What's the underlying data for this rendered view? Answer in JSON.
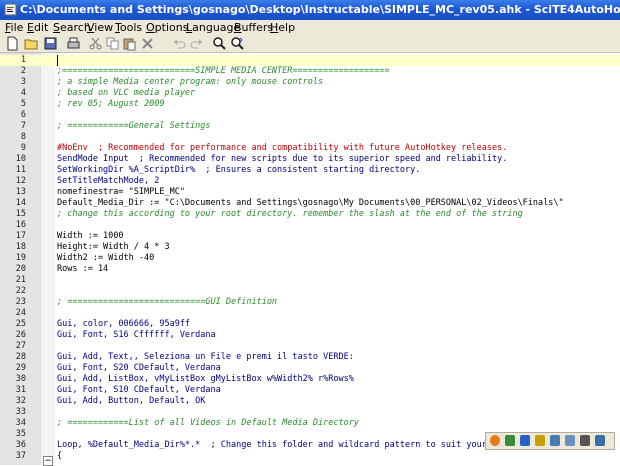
{
  "window": {
    "title": "C:\\Documents and Settings\\gosnago\\Desktop\\Instructable\\SIMPLE_MC_rev05.ahk - SciTE4AutoHotkey"
  },
  "menu": [
    "File",
    "Edit",
    "Search",
    "View",
    "Tools",
    "Options",
    "Language",
    "Buffers",
    "Help"
  ],
  "toolbar": [
    "new-file-icon",
    "open-folder-icon",
    "save-icon",
    "print-icon",
    "cut-icon",
    "copy-icon",
    "paste-icon",
    "delete-icon",
    "undo-icon",
    "redo-icon",
    "find-icon",
    "replace-icon"
  ],
  "editor": {
    "current_line": 1,
    "lines": [
      {
        "n": "1",
        "t": "",
        "s": "plain"
      },
      {
        "n": "2",
        "t": ";==========================SIMPLE MEDIA CENTER===================",
        "s": "comment"
      },
      {
        "n": "3",
        "t": "; a simple Media center program: only mouse controls",
        "s": "comment"
      },
      {
        "n": "4",
        "t": "; based on VLC media player",
        "s": "comment"
      },
      {
        "n": "5",
        "t": "; rev 05; August 2009",
        "s": "comment"
      },
      {
        "n": "6",
        "t": "",
        "s": "plain"
      },
      {
        "n": "7",
        "t": "; ============General Settings",
        "s": "comment"
      },
      {
        "n": "8",
        "t": "",
        "s": "plain"
      },
      {
        "n": "9",
        "t": "#NoEnv  ; Recommended for performance and compatibility with future AutoHotkey releases.",
        "s": "directive"
      },
      {
        "n": "10",
        "t": "SendMode Input  ; Recommended for new scripts due to its superior speed and reliability.",
        "s": "cmd"
      },
      {
        "n": "11",
        "t": "SetWorkingDir %A_ScriptDir%  ; Ensures a consistent starting directory.",
        "s": "cmd"
      },
      {
        "n": "12",
        "t": "SetTitleMatchMode, 2",
        "s": "cmd"
      },
      {
        "n": "13",
        "t": "nomefinestra= \"SIMPLE_MC\"",
        "s": "plain"
      },
      {
        "n": "14",
        "t": "Default_Media_Dir := \"C:\\Documents and Settings\\gosnago\\My Documents\\00_PERSONAL\\02_Videos\\Finals\\\"",
        "s": "plain"
      },
      {
        "n": "15",
        "t": "; change this according to your root directory. remember the slash at the end of the string",
        "s": "comment"
      },
      {
        "n": "16",
        "t": "",
        "s": "plain"
      },
      {
        "n": "17",
        "t": "Width := 1000",
        "s": "plain"
      },
      {
        "n": "18",
        "t": "Height:= Width / 4 * 3",
        "s": "plain"
      },
      {
        "n": "19",
        "t": "Width2 := Width -40",
        "s": "plain"
      },
      {
        "n": "20",
        "t": "Rows := 14",
        "s": "plain"
      },
      {
        "n": "21",
        "t": "",
        "s": "plain"
      },
      {
        "n": "22",
        "t": "",
        "s": "plain"
      },
      {
        "n": "23",
        "t": "; ===========================GUI Definition",
        "s": "comment"
      },
      {
        "n": "24",
        "t": "",
        "s": "plain"
      },
      {
        "n": "25",
        "t": "Gui, color, 006666, 95a9ff",
        "s": "cmd"
      },
      {
        "n": "26",
        "t": "Gui, Font, S16 Cffffff, Verdana",
        "s": "cmd"
      },
      {
        "n": "27",
        "t": "",
        "s": "plain"
      },
      {
        "n": "28",
        "t": "Gui, Add, Text,, Seleziona un File e premi il tasto VERDE:",
        "s": "cmd"
      },
      {
        "n": "29",
        "t": "Gui, Font, S20 CDefault, Verdana",
        "s": "cmd"
      },
      {
        "n": "30",
        "t": "Gui, Add, ListBox, vMyListBox gMyListBox w%Width2% r%Rows%",
        "s": "cmd"
      },
      {
        "n": "31",
        "t": "Gui, Font, S10 CDefault, Verdana",
        "s": "cmd"
      },
      {
        "n": "32",
        "t": "Gui, Add, Button, Default, OK",
        "s": "cmd"
      },
      {
        "n": "33",
        "t": "",
        "s": "plain"
      },
      {
        "n": "34",
        "t": "; ============List of all Videos in Default Media Directory",
        "s": "comment"
      },
      {
        "n": "35",
        "t": "",
        "s": "plain"
      },
      {
        "n": "36",
        "t": "Loop, %Default_Media_Dir%*.*  ; Change this folder and wildcard pattern to suit your",
        "s": "cmd"
      },
      {
        "n": "37",
        "t": "{",
        "s": "plain"
      }
    ]
  },
  "tray_icons": [
    "vlc-icon",
    "autohotkey-icon",
    "windows-icon",
    "shield-icon",
    "monitor-icon",
    "network-icon",
    "speaker-icon",
    "keyboard-icon"
  ]
}
